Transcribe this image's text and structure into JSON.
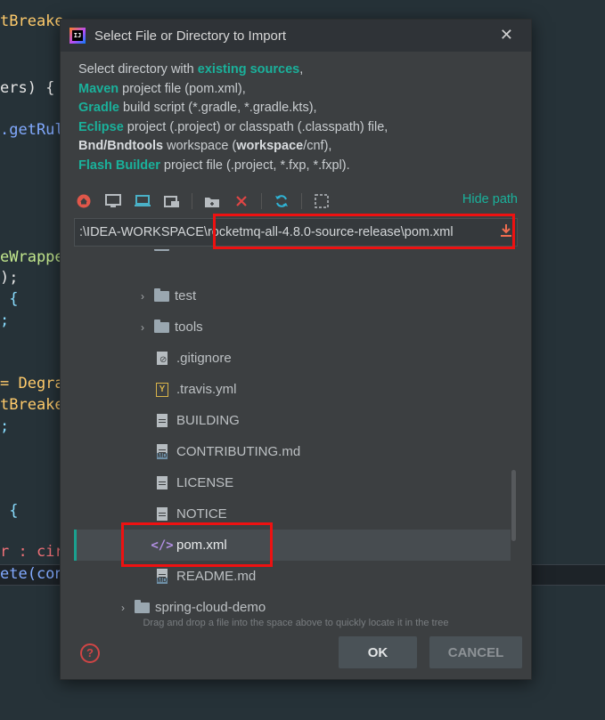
{
  "editor": {
    "lines": [
      {
        "text": "tBreake",
        "color": "#ffcb6b"
      },
      {
        "text": "ers) {",
        "color": "#e6e6e6"
      },
      {
        "text": ".getRul",
        "color": "#82aaff"
      },
      {
        "text": "eWrappe",
        "color": "#c3e88d"
      },
      {
        "text": ");",
        "color": "#e6e6e6"
      },
      {
        "text": " {",
        "color": "#e6e6e6"
      },
      {
        "text": ";",
        "color": "#e6e6e6"
      },
      {
        "text": "= Degra",
        "color": "#ffcb6b"
      },
      {
        "text": "tBreake",
        "color": "#ffcb6b"
      },
      {
        "text": ";",
        "color": "#e6e6e6"
      },
      {
        "text": " {",
        "color": "#e6e6e6"
      },
      {
        "text": "r : cir",
        "color": "#e6e6e6"
      },
      {
        "text": "ete(con",
        "color": "#82aaff"
      }
    ]
  },
  "dialog": {
    "title": "Select File or Directory to Import",
    "close_glyph": "✕",
    "description": {
      "line1_pre": "Select directory with ",
      "line1_em": "existing sources",
      "line1_post": ",",
      "line2_em": "Maven",
      "line2_post": " project file (pom.xml),",
      "line3_em": "Gradle",
      "line3_post": " build script (*.gradle, *.gradle.kts),",
      "line4_em": "Eclipse",
      "line4_post": " project (.project) or classpath (.classpath) file,",
      "line5_em": "Bnd/Bndtools",
      "line5_mid": " workspace (",
      "line5_strong": "workspace",
      "line5_post": "/cnf),",
      "line6_em": "Flash Builder",
      "line6_post": " project file (.project, *.fxp, *.fxpl)."
    },
    "toolbar": {
      "icons": [
        "home-icon",
        "desktop-icon",
        "project-icon",
        "module-icon",
        "new-folder-icon",
        "delete-icon",
        "refresh-icon",
        "show-hidden-icon"
      ],
      "hide_path_label": "Hide path"
    },
    "path": {
      "value": ":\\IDEA-WORKSPACE\\rocketmq-all-4.8.0-source-release\\pom.xml"
    },
    "tree": {
      "rows": [
        {
          "label": "test",
          "type": "folder",
          "expandable": true
        },
        {
          "label": "tools",
          "type": "folder",
          "expandable": true
        },
        {
          "label": ".gitignore",
          "type": "git-file"
        },
        {
          "label": ".travis.yml",
          "type": "yml-file"
        },
        {
          "label": "BUILDING",
          "type": "text-file"
        },
        {
          "label": "CONTRIBUTING.md",
          "type": "md-file"
        },
        {
          "label": "LICENSE",
          "type": "text-file"
        },
        {
          "label": "NOTICE",
          "type": "text-file"
        },
        {
          "label": "pom.xml",
          "type": "xml-file",
          "selected": true
        },
        {
          "label": "README.md",
          "type": "md-file"
        },
        {
          "label": "spring-cloud-demo",
          "type": "folder",
          "expandable": true
        }
      ]
    },
    "hint": "Drag and drop a file into the space above to quickly locate it in the tree",
    "buttons": {
      "help": "?",
      "ok": "OK",
      "cancel": "CANCEL"
    }
  }
}
